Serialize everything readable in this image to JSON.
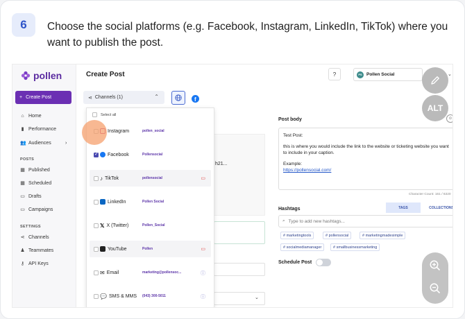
{
  "step": {
    "number": "6",
    "text": "Choose the social platforms (e.g. Facebook, Instagram, LinkedIn, TikTok) where you want to publish the post."
  },
  "app": {
    "brand": "pollen",
    "page_title": "Create Post",
    "help_label": "?",
    "account_initials": "PS",
    "account_name": "Pollen Social"
  },
  "sidebar": {
    "create_post": "Create Post",
    "main": [
      {
        "label": "Home",
        "icon": "home-icon"
      },
      {
        "label": "Performance",
        "icon": "bar-chart-icon"
      },
      {
        "label": "Audiences",
        "icon": "people-icon",
        "has_chevron": true
      }
    ],
    "posts_heading": "POSTS",
    "posts": [
      {
        "label": "Published",
        "icon": "calendar-check-icon"
      },
      {
        "label": "Scheduled",
        "icon": "calendar-icon"
      },
      {
        "label": "Drafts",
        "icon": "document-icon"
      },
      {
        "label": "Campaigns",
        "icon": "folder-icon"
      }
    ],
    "settings_heading": "SETTINGS",
    "settings": [
      {
        "label": "Channels",
        "icon": "share-icon"
      },
      {
        "label": "Teammates",
        "icon": "user-plus-icon"
      },
      {
        "label": "API Keys",
        "icon": "key-icon"
      }
    ]
  },
  "channels": {
    "selector_label": "Channels (1)",
    "select_all": "Select all",
    "items": [
      {
        "platform": "Instagram",
        "account": "pollen_social",
        "checked": false,
        "icon_color": "#c13584"
      },
      {
        "platform": "Facebook",
        "account": "Pollensocial",
        "checked": true,
        "icon_color": "#1877f2"
      },
      {
        "platform": "TikTok",
        "account": "pollensocial",
        "checked": false,
        "icon_color": "#111111",
        "right_icon": "video-icon"
      },
      {
        "platform": "LinkedIn",
        "account": "Pollen Social",
        "checked": false,
        "icon_color": "#0a66c2"
      },
      {
        "platform": "X (Twitter)",
        "account": "Pollen_Social",
        "checked": false,
        "icon_color": "#111111"
      },
      {
        "platform": "YouTube",
        "account": "Pollen",
        "checked": false,
        "icon_color": "#ff0000",
        "right_icon": "video-icon"
      },
      {
        "platform": "Email",
        "account": "marketing@pollensoc...",
        "checked": false,
        "icon_color": "#333333",
        "right_icon": "info-icon"
      },
      {
        "platform": "SMS & MMS",
        "account": "(043) 300-5011",
        "checked": false,
        "icon_color": "#333333",
        "right_icon": "info-icon"
      }
    ]
  },
  "middle": {
    "partial_text": "h21..."
  },
  "post_body": {
    "label": "Post body",
    "line1": "Test Post:",
    "line2": "this is where you would include the link to the website or ticketing website you want to include in your caption.",
    "line3": "Example:",
    "link": "https://pollensocial.com/",
    "char_count": "Character Count: 161 / 6320"
  },
  "hashtags": {
    "label": "Hashtags",
    "tab_tags": "TAGS",
    "tab_collections": "COLLECTIONS",
    "placeholder": "Type to add new hashtags...",
    "chips": [
      "# marketingtools",
      "# pollensocial",
      "# marketingmadesimple",
      "# socialmediamanager",
      "# smallbusinessmarketing"
    ]
  },
  "schedule": {
    "label": "Schedule Post"
  },
  "overlay": {
    "alt_label": "ALT"
  },
  "colors": {
    "brand_purple": "#6b2fb3",
    "link_blue": "#2155c8",
    "highlight_orange": "#f5a06e"
  }
}
